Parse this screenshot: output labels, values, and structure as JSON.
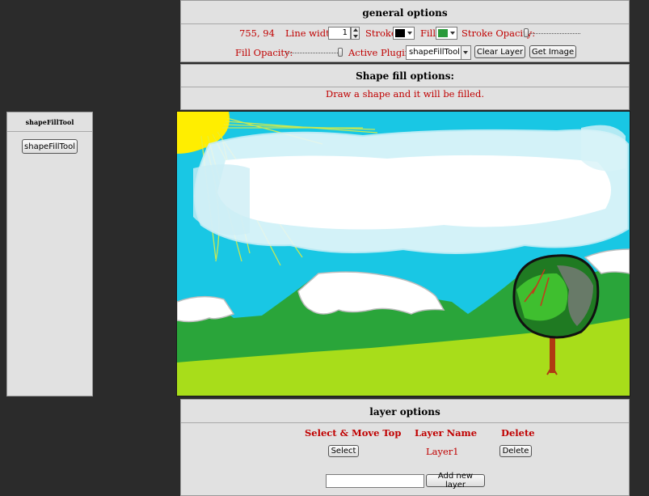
{
  "general": {
    "title": "general options",
    "coords": "755, 94",
    "line_width_label": "Line width:",
    "line_width_value": "1",
    "stroke_label": "Stroke:",
    "fill_label": "Fill:",
    "stroke_opacity_label": "Stroke Opacity:",
    "fill_opacity_label": "Fill Opacity:",
    "active_plugin_label": "Active Plugin:",
    "active_plugin_value": "shapeFillTool",
    "clear_layer_label": "Clear Layer",
    "get_image_label": "Get Image",
    "stroke_color": "#000000",
    "fill_color": "#2a9a3a",
    "stroke_opacity": 0.0,
    "fill_opacity": 1.0
  },
  "shape_fill": {
    "title": "Shape fill options:",
    "message": "Draw a shape and it will be filled."
  },
  "tools": {
    "title": "shapeFillTool",
    "button_label": "shapeFillTool"
  },
  "layers": {
    "title": "layer options",
    "col_select": "Select & Move Top",
    "col_name": "Layer Name",
    "col_delete": "Delete",
    "rows": [
      {
        "select_label": "Select",
        "name": "Layer1",
        "delete_label": "Delete"
      }
    ],
    "new_layer_value": "",
    "add_layer_label": "Add new layer"
  },
  "colors": {
    "sky": "#19c7e4",
    "grass": "#2aa53a",
    "meadow": "#a8dd1a",
    "sun": "#ffee00"
  }
}
